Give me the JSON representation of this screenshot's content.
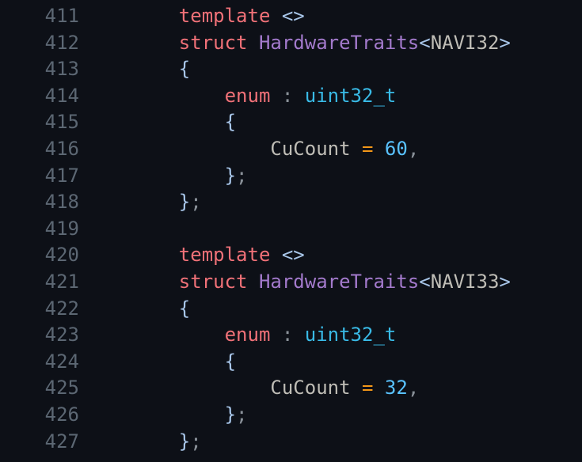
{
  "editor": {
    "background_color": "#0d1017",
    "gutter_color": "#5c6773",
    "first_line_number": 411,
    "last_line_number": 427,
    "language": "cpp"
  },
  "palette": {
    "keyword": "#f07178",
    "type": "#a37acc",
    "builtin_type": "#39bae6",
    "identifier": "#bfbdb6",
    "number": "#59c2ff",
    "operator": "#f29718",
    "brace": "#a7c5e8",
    "punctuation": "#8a9199"
  },
  "lines": [
    {
      "number": "411",
      "tokens": [
        {
          "text": "    ",
          "kind": "plain"
        },
        {
          "text": "template",
          "kind": "keyword"
        },
        {
          "text": " ",
          "kind": "plain"
        },
        {
          "text": "<>",
          "kind": "angle"
        }
      ]
    },
    {
      "number": "412",
      "tokens": [
        {
          "text": "    ",
          "kind": "plain"
        },
        {
          "text": "struct",
          "kind": "keyword"
        },
        {
          "text": " ",
          "kind": "plain"
        },
        {
          "text": "HardwareTraits",
          "kind": "type"
        },
        {
          "text": "<",
          "kind": "angle"
        },
        {
          "text": "NAVI32",
          "kind": "ident"
        },
        {
          "text": ">",
          "kind": "angle"
        }
      ]
    },
    {
      "number": "413",
      "tokens": [
        {
          "text": "    ",
          "kind": "plain"
        },
        {
          "text": "{",
          "kind": "brace"
        }
      ]
    },
    {
      "number": "414",
      "tokens": [
        {
          "text": "        ",
          "kind": "plain"
        },
        {
          "text": "enum",
          "kind": "keyword"
        },
        {
          "text": " ",
          "kind": "plain"
        },
        {
          "text": ":",
          "kind": "punct"
        },
        {
          "text": " ",
          "kind": "plain"
        },
        {
          "text": "uint32_t",
          "kind": "builtin"
        }
      ]
    },
    {
      "number": "415",
      "tokens": [
        {
          "text": "        ",
          "kind": "plain"
        },
        {
          "text": "{",
          "kind": "brace"
        }
      ]
    },
    {
      "number": "416",
      "tokens": [
        {
          "text": "            ",
          "kind": "plain"
        },
        {
          "text": "CuCount",
          "kind": "ident"
        },
        {
          "text": " ",
          "kind": "plain"
        },
        {
          "text": "=",
          "kind": "operator"
        },
        {
          "text": " ",
          "kind": "plain"
        },
        {
          "text": "60",
          "kind": "number"
        },
        {
          "text": ",",
          "kind": "punct"
        }
      ]
    },
    {
      "number": "417",
      "tokens": [
        {
          "text": "        ",
          "kind": "plain"
        },
        {
          "text": "}",
          "kind": "brace"
        },
        {
          "text": ";",
          "kind": "punct"
        }
      ]
    },
    {
      "number": "418",
      "tokens": [
        {
          "text": "    ",
          "kind": "plain"
        },
        {
          "text": "}",
          "kind": "brace"
        },
        {
          "text": ";",
          "kind": "punct"
        }
      ]
    },
    {
      "number": "419",
      "tokens": []
    },
    {
      "number": "420",
      "tokens": [
        {
          "text": "    ",
          "kind": "plain"
        },
        {
          "text": "template",
          "kind": "keyword"
        },
        {
          "text": " ",
          "kind": "plain"
        },
        {
          "text": "<>",
          "kind": "angle"
        }
      ]
    },
    {
      "number": "421",
      "tokens": [
        {
          "text": "    ",
          "kind": "plain"
        },
        {
          "text": "struct",
          "kind": "keyword"
        },
        {
          "text": " ",
          "kind": "plain"
        },
        {
          "text": "HardwareTraits",
          "kind": "type"
        },
        {
          "text": "<",
          "kind": "angle"
        },
        {
          "text": "NAVI33",
          "kind": "ident"
        },
        {
          "text": ">",
          "kind": "angle"
        }
      ]
    },
    {
      "number": "422",
      "tokens": [
        {
          "text": "    ",
          "kind": "plain"
        },
        {
          "text": "{",
          "kind": "brace"
        }
      ]
    },
    {
      "number": "423",
      "tokens": [
        {
          "text": "        ",
          "kind": "plain"
        },
        {
          "text": "enum",
          "kind": "keyword"
        },
        {
          "text": " ",
          "kind": "plain"
        },
        {
          "text": ":",
          "kind": "punct"
        },
        {
          "text": " ",
          "kind": "plain"
        },
        {
          "text": "uint32_t",
          "kind": "builtin"
        }
      ]
    },
    {
      "number": "424",
      "tokens": [
        {
          "text": "        ",
          "kind": "plain"
        },
        {
          "text": "{",
          "kind": "brace"
        }
      ]
    },
    {
      "number": "425",
      "tokens": [
        {
          "text": "            ",
          "kind": "plain"
        },
        {
          "text": "CuCount",
          "kind": "ident"
        },
        {
          "text": " ",
          "kind": "plain"
        },
        {
          "text": "=",
          "kind": "operator"
        },
        {
          "text": " ",
          "kind": "plain"
        },
        {
          "text": "32",
          "kind": "number"
        },
        {
          "text": ",",
          "kind": "punct"
        }
      ]
    },
    {
      "number": "426",
      "tokens": [
        {
          "text": "        ",
          "kind": "plain"
        },
        {
          "text": "}",
          "kind": "brace"
        },
        {
          "text": ";",
          "kind": "punct"
        }
      ]
    },
    {
      "number": "427",
      "tokens": [
        {
          "text": "    ",
          "kind": "plain"
        },
        {
          "text": "}",
          "kind": "brace"
        },
        {
          "text": ";",
          "kind": "punct"
        }
      ]
    }
  ]
}
